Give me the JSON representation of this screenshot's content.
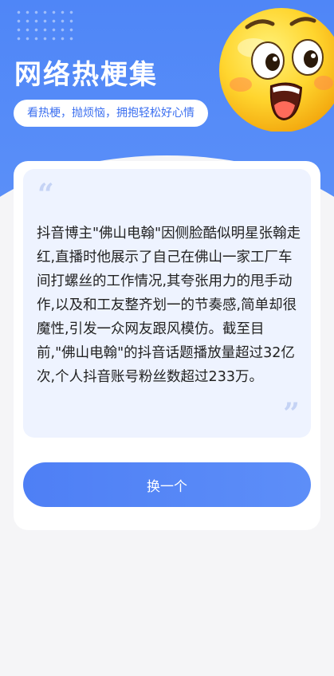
{
  "header": {
    "title": "网络热梗集",
    "subtitle": "看热梗，抛烦恼，拥抱轻松好心情",
    "mascot_icon": "laughing-emoji-icon",
    "brand_color": "#4f86f7"
  },
  "joke": {
    "open_quote": "“",
    "close_quote": "”",
    "text": "抖音博主\"佛山电翰\"因侧脸酷似明星张翰走红,直播时他展示了自己在佛山一家工厂车间打螺丝的工作情况,其夸张用力的甩手动作,以及和工友整齐划一的节奏感,简单却很魔性,引发一众网友跟风模仿。截至目前,\"佛山电翰\"的抖音话题播放量超过32亿次,个人抖音账号粉丝数超过233万。"
  },
  "actions": {
    "change_label": "换一个"
  }
}
